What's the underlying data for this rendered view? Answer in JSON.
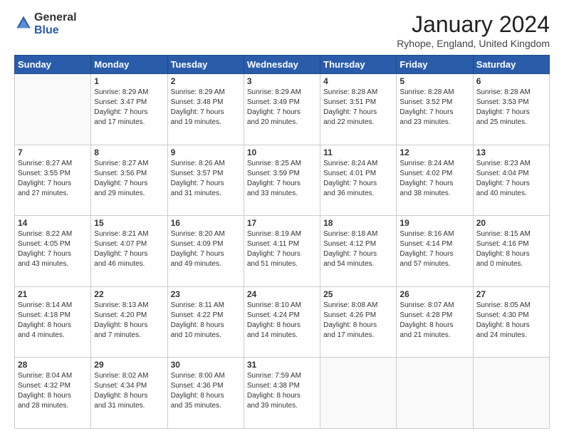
{
  "logo": {
    "line1": "General",
    "line2": "Blue"
  },
  "header": {
    "month_year": "January 2024",
    "location": "Ryhope, England, United Kingdom"
  },
  "days_of_week": [
    "Sunday",
    "Monday",
    "Tuesday",
    "Wednesday",
    "Thursday",
    "Friday",
    "Saturday"
  ],
  "weeks": [
    [
      {
        "day": "",
        "info": ""
      },
      {
        "day": "1",
        "info": "Sunrise: 8:29 AM\nSunset: 3:47 PM\nDaylight: 7 hours\nand 17 minutes."
      },
      {
        "day": "2",
        "info": "Sunrise: 8:29 AM\nSunset: 3:48 PM\nDaylight: 7 hours\nand 19 minutes."
      },
      {
        "day": "3",
        "info": "Sunrise: 8:29 AM\nSunset: 3:49 PM\nDaylight: 7 hours\nand 20 minutes."
      },
      {
        "day": "4",
        "info": "Sunrise: 8:28 AM\nSunset: 3:51 PM\nDaylight: 7 hours\nand 22 minutes."
      },
      {
        "day": "5",
        "info": "Sunrise: 8:28 AM\nSunset: 3:52 PM\nDaylight: 7 hours\nand 23 minutes."
      },
      {
        "day": "6",
        "info": "Sunrise: 8:28 AM\nSunset: 3:53 PM\nDaylight: 7 hours\nand 25 minutes."
      }
    ],
    [
      {
        "day": "7",
        "info": "Sunrise: 8:27 AM\nSunset: 3:55 PM\nDaylight: 7 hours\nand 27 minutes."
      },
      {
        "day": "8",
        "info": "Sunrise: 8:27 AM\nSunset: 3:56 PM\nDaylight: 7 hours\nand 29 minutes."
      },
      {
        "day": "9",
        "info": "Sunrise: 8:26 AM\nSunset: 3:57 PM\nDaylight: 7 hours\nand 31 minutes."
      },
      {
        "day": "10",
        "info": "Sunrise: 8:25 AM\nSunset: 3:59 PM\nDaylight: 7 hours\nand 33 minutes."
      },
      {
        "day": "11",
        "info": "Sunrise: 8:24 AM\nSunset: 4:01 PM\nDaylight: 7 hours\nand 36 minutes."
      },
      {
        "day": "12",
        "info": "Sunrise: 8:24 AM\nSunset: 4:02 PM\nDaylight: 7 hours\nand 38 minutes."
      },
      {
        "day": "13",
        "info": "Sunrise: 8:23 AM\nSunset: 4:04 PM\nDaylight: 7 hours\nand 40 minutes."
      }
    ],
    [
      {
        "day": "14",
        "info": "Sunrise: 8:22 AM\nSunset: 4:05 PM\nDaylight: 7 hours\nand 43 minutes."
      },
      {
        "day": "15",
        "info": "Sunrise: 8:21 AM\nSunset: 4:07 PM\nDaylight: 7 hours\nand 46 minutes."
      },
      {
        "day": "16",
        "info": "Sunrise: 8:20 AM\nSunset: 4:09 PM\nDaylight: 7 hours\nand 49 minutes."
      },
      {
        "day": "17",
        "info": "Sunrise: 8:19 AM\nSunset: 4:11 PM\nDaylight: 7 hours\nand 51 minutes."
      },
      {
        "day": "18",
        "info": "Sunrise: 8:18 AM\nSunset: 4:12 PM\nDaylight: 7 hours\nand 54 minutes."
      },
      {
        "day": "19",
        "info": "Sunrise: 8:16 AM\nSunset: 4:14 PM\nDaylight: 7 hours\nand 57 minutes."
      },
      {
        "day": "20",
        "info": "Sunrise: 8:15 AM\nSunset: 4:16 PM\nDaylight: 8 hours\nand 0 minutes."
      }
    ],
    [
      {
        "day": "21",
        "info": "Sunrise: 8:14 AM\nSunset: 4:18 PM\nDaylight: 8 hours\nand 4 minutes."
      },
      {
        "day": "22",
        "info": "Sunrise: 8:13 AM\nSunset: 4:20 PM\nDaylight: 8 hours\nand 7 minutes."
      },
      {
        "day": "23",
        "info": "Sunrise: 8:11 AM\nSunset: 4:22 PM\nDaylight: 8 hours\nand 10 minutes."
      },
      {
        "day": "24",
        "info": "Sunrise: 8:10 AM\nSunset: 4:24 PM\nDaylight: 8 hours\nand 14 minutes."
      },
      {
        "day": "25",
        "info": "Sunrise: 8:08 AM\nSunset: 4:26 PM\nDaylight: 8 hours\nand 17 minutes."
      },
      {
        "day": "26",
        "info": "Sunrise: 8:07 AM\nSunset: 4:28 PM\nDaylight: 8 hours\nand 21 minutes."
      },
      {
        "day": "27",
        "info": "Sunrise: 8:05 AM\nSunset: 4:30 PM\nDaylight: 8 hours\nand 24 minutes."
      }
    ],
    [
      {
        "day": "28",
        "info": "Sunrise: 8:04 AM\nSunset: 4:32 PM\nDaylight: 8 hours\nand 28 minutes."
      },
      {
        "day": "29",
        "info": "Sunrise: 8:02 AM\nSunset: 4:34 PM\nDaylight: 8 hours\nand 31 minutes."
      },
      {
        "day": "30",
        "info": "Sunrise: 8:00 AM\nSunset: 4:36 PM\nDaylight: 8 hours\nand 35 minutes."
      },
      {
        "day": "31",
        "info": "Sunrise: 7:59 AM\nSunset: 4:38 PM\nDaylight: 8 hours\nand 39 minutes."
      },
      {
        "day": "",
        "info": ""
      },
      {
        "day": "",
        "info": ""
      },
      {
        "day": "",
        "info": ""
      }
    ]
  ]
}
